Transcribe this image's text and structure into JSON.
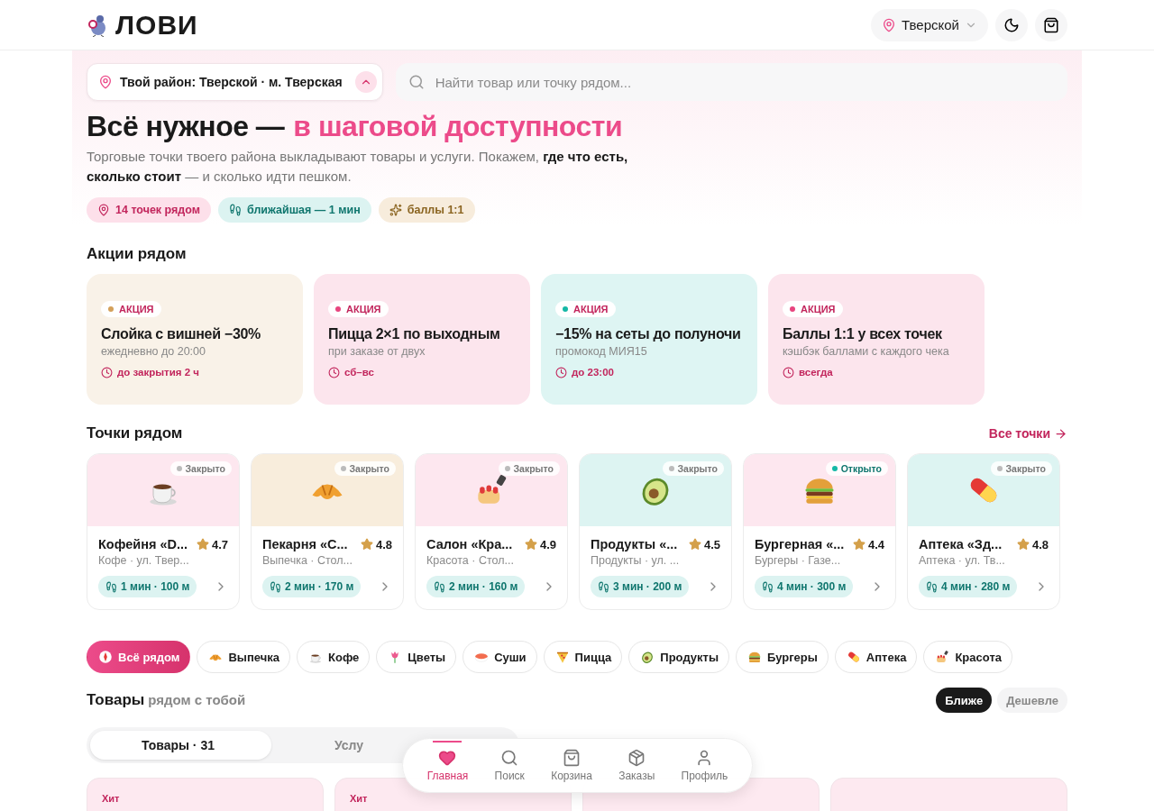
{
  "header": {
    "logo": "ЛОВИ",
    "district": "Тверской"
  },
  "hero": {
    "district_picker": "Твой район: Тверской · м. Тверская",
    "search": {
      "placeholder": "Найти товар или точку рядом..."
    },
    "title": "Всё нужное —",
    "title_accent": "в шаговой доступности",
    "lead": "Торговые точки твоего района выкладывают товары и услуги. Покажем, **где что есть, сколько стоит** — и сколько идти пешком.",
    "chips": [
      {
        "kind": "pin",
        "label": "14 точек рядом"
      },
      {
        "kind": "walk",
        "label": "ближайшая — 1 мин"
      },
      {
        "kind": "spark",
        "label": "баллы 1:1"
      }
    ]
  },
  "promos": {
    "title": "Акции рядом",
    "items": [
      {
        "color": "#d4a05a",
        "badge": "АКЦИЯ",
        "title": "Слойка с вишней −30%",
        "subtitle": "ежедневно до 20:00",
        "when": "до закрытия 2 ч"
      },
      {
        "color": "#e8457f",
        "badge": "АКЦИЯ",
        "title": "Пицца 2×1 по выходным",
        "subtitle": "при заказе от двух",
        "when": "сб–вс"
      },
      {
        "color": "#14b8a6",
        "badge": "АКЦИЯ",
        "title": "−15% на сеты до полуночи",
        "subtitle": "промокод МИЯ15",
        "when": "до 23:00"
      },
      {
        "color": "#e8457f",
        "badge": "АКЦИЯ",
        "title": "Баллы 1:1 у всех точек",
        "subtitle": "кэшбэк баллами с каждого чека",
        "when": "всегда"
      }
    ]
  },
  "places": {
    "title": "Точки рядом",
    "all_link": "Все точки",
    "items": [
      {
        "kind": "coffee",
        "color": "#fde7ef",
        "open": false,
        "status": "Закрыто",
        "name": "Кофейня «D...",
        "rating": "4.7",
        "meta": "Кофе · ул. Твер...",
        "walk": "1 мин · 100 м"
      },
      {
        "kind": "croissant",
        "color": "#f8eddc",
        "open": false,
        "status": "Закрыто",
        "name": "Пекарня «С...",
        "rating": "4.8",
        "meta": "Выпечка · Стол...",
        "walk": "2 мин · 170 м"
      },
      {
        "kind": "nails",
        "color": "#fde7ef",
        "open": false,
        "status": "Закрыто",
        "name": "Салон «Кра...",
        "rating": "4.9",
        "meta": "Красота · Стол...",
        "walk": "2 мин · 160 м"
      },
      {
        "kind": "avocado",
        "color": "#ddf4f2",
        "open": false,
        "status": "Закрыто",
        "name": "Продукты «...",
        "rating": "4.5",
        "meta": "Продукты · ул. ...",
        "walk": "3 мин · 200 м"
      },
      {
        "kind": "burger",
        "color": "#fde7ef",
        "open": true,
        "status": "Открыто",
        "name": "Бургерная «...",
        "rating": "4.4",
        "meta": "Бургеры · Газе...",
        "walk": "4 мин · 300 м"
      },
      {
        "kind": "pill",
        "color": "#ddf4f2",
        "open": false,
        "status": "Закрыто",
        "name": "Аптека «Зд...",
        "rating": "4.8",
        "meta": "Аптека · ул. Тв...",
        "walk": "4 мин · 280 м"
      }
    ]
  },
  "categories": [
    {
      "kind": "compass",
      "label": "Всё рядом",
      "selected": true
    },
    {
      "kind": "croissant",
      "label": "Выпечка",
      "selected": false
    },
    {
      "kind": "coffee",
      "label": "Кофе",
      "selected": false
    },
    {
      "kind": "flower",
      "label": "Цветы",
      "selected": false
    },
    {
      "kind": "sushi",
      "label": "Суши",
      "selected": false
    },
    {
      "kind": "pizza",
      "label": "Пицца",
      "selected": false
    },
    {
      "kind": "avocado",
      "label": "Продукты",
      "selected": false
    },
    {
      "kind": "burger",
      "label": "Бургеры",
      "selected": false
    },
    {
      "kind": "pill",
      "label": "Аптека",
      "selected": false
    },
    {
      "kind": "nails",
      "label": "Красота",
      "selected": false
    }
  ],
  "goods": {
    "title": "Товары",
    "subtitle": "рядом с тобой",
    "sort": [
      {
        "label": "Ближе",
        "selected": true
      },
      {
        "label": "Дешевле",
        "selected": false
      }
    ],
    "segments": [
      {
        "label": "Товары · 31",
        "selected": true
      },
      {
        "label": "Услу",
        "selected": false
      }
    ],
    "cards": [
      {
        "kind": "hit",
        "badge": "Хит"
      },
      {
        "kind": "hit",
        "badge": "Хит"
      },
      {
        "kind": "plain"
      },
      {
        "kind": "plain"
      }
    ]
  },
  "nav": [
    {
      "kind": "home",
      "label": "Главная",
      "selected": true
    },
    {
      "kind": "search",
      "label": "Поиск",
      "selected": false
    },
    {
      "kind": "cart",
      "label": "Корзина",
      "selected": false
    },
    {
      "kind": "orders",
      "label": "Заказы",
      "selected": false
    },
    {
      "kind": "profile",
      "label": "Профиль",
      "selected": false
    }
  ]
}
